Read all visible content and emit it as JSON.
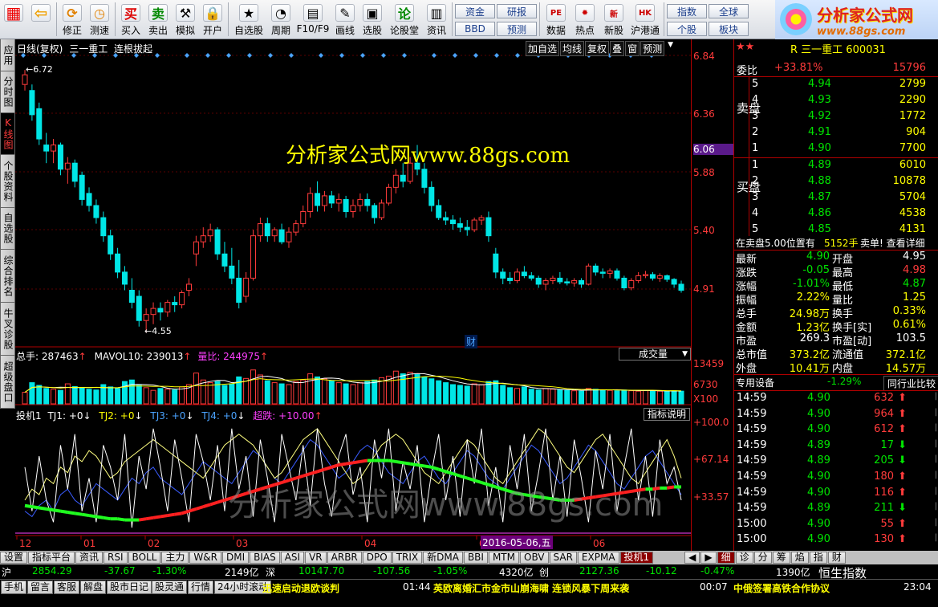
{
  "toolbar": {
    "items": [
      {
        "label": "",
        "icon": "windows-grid-icon"
      },
      {
        "label": "",
        "icon": "back-arrow-icon"
      },
      {
        "label": "修正",
        "icon": "refresh-icon"
      },
      {
        "label": "测速",
        "icon": "clock-icon"
      },
      {
        "label": "买入",
        "icon": "buy-icon",
        "glyph": "买"
      },
      {
        "label": "卖出",
        "icon": "sell-icon",
        "glyph": "卖"
      },
      {
        "label": "模拟",
        "icon": "hammer-icon"
      },
      {
        "label": "开户",
        "icon": "lock-icon"
      },
      {
        "label": "自选股",
        "icon": "star-icon"
      },
      {
        "label": "周期",
        "icon": "cycle-icon"
      },
      {
        "label": "F10/F9",
        "icon": "f10-icon"
      },
      {
        "label": "画线",
        "icon": "pen-icon"
      },
      {
        "label": "选股",
        "icon": "screen-icon"
      },
      {
        "label": "论股堂",
        "icon": "discuss-icon",
        "glyph": "论"
      },
      {
        "label": "资讯",
        "icon": "news-icon"
      }
    ],
    "mini": [
      [
        "资金",
        "BBD"
      ],
      [
        "研报",
        "预测"
      ]
    ],
    "items2": [
      {
        "label": "数据",
        "icon": "pe-icon",
        "glyph": "PE"
      },
      {
        "label": "热点",
        "icon": "hot-icon"
      },
      {
        "label": "新股",
        "icon": "new-stock-icon",
        "glyph": "新"
      },
      {
        "label": "沪港通",
        "icon": "hk-link-icon",
        "glyph": "HK"
      }
    ],
    "mini2": [
      [
        "指数",
        "个股"
      ],
      [
        "全球",
        "板块"
      ]
    ]
  },
  "logo": {
    "title": "分析家公式网",
    "url": "www.88gs.com"
  },
  "vtabs": [
    {
      "label": "应用"
    },
    {
      "label": "分时图"
    },
    {
      "label": "K线图",
      "active": true
    },
    {
      "label": "个股资料"
    },
    {
      "label": "自选股"
    },
    {
      "label": "综合排名"
    },
    {
      "label": "牛叉诊股"
    },
    {
      "label": "超级盘口"
    }
  ],
  "chart": {
    "header": {
      "period": "日线(复权)",
      "name": "三一重工",
      "signal": "连根拔起"
    },
    "menu": [
      "加自选",
      "均线",
      "复权",
      "叠",
      "窗",
      "预测"
    ],
    "high_label": "6.72",
    "low_label": "4.55",
    "watermark1": "分析家公式网www.88gs.com",
    "watermark2": "分析家公式网www.88gs.com",
    "cai": "财",
    "price_axis": [
      "6.84",
      "6.36",
      "6.06",
      "5.88",
      "5.40",
      "4.91"
    ],
    "vol_title": "总手: 287463",
    "mavol": "MAVOL10: 239013",
    "liangbi": "量比: 244975",
    "vol_select": "成交量",
    "vol_axis": [
      "13459",
      "6730",
      "X100"
    ],
    "ind_title": "投机1",
    "tj1": "TJ1: +0",
    "tj2": "TJ2: +0",
    "tj3": "TJ3: +0",
    "tj4": "TJ4: +0",
    "chaodie": "超跌: +10.00",
    "ind_btn": "指标说明",
    "ind_axis": [
      "+100.0",
      "+67.14",
      "+33.57"
    ],
    "months": [
      "12",
      "01",
      "02",
      "03",
      "04",
      "05",
      "06"
    ],
    "date_label": "2016-05-06,五"
  },
  "chart_data": {
    "type": "candlestick",
    "ylim": [
      4.55,
      6.84
    ],
    "ohlc": [
      [
        6.6,
        6.72,
        6.55,
        6.68
      ],
      [
        6.55,
        6.6,
        6.3,
        6.35
      ],
      [
        6.4,
        6.45,
        6.1,
        6.15
      ],
      [
        6.1,
        6.2,
        5.95,
        6.05
      ],
      [
        6.05,
        6.15,
        5.95,
        6.1
      ],
      [
        6.1,
        6.12,
        5.85,
        5.9
      ],
      [
        5.9,
        6.0,
        5.78,
        5.95
      ],
      [
        5.95,
        5.98,
        5.75,
        5.8
      ],
      [
        5.85,
        5.88,
        5.6,
        5.65
      ],
      [
        5.7,
        5.75,
        5.55,
        5.6
      ],
      [
        5.6,
        5.65,
        5.45,
        5.5
      ],
      [
        5.5,
        5.55,
        5.3,
        5.35
      ],
      [
        5.35,
        5.4,
        5.15,
        5.2
      ],
      [
        5.2,
        5.25,
        5.0,
        5.05
      ],
      [
        5.05,
        5.1,
        4.9,
        4.95
      ],
      [
        4.9,
        5.0,
        4.75,
        4.8
      ],
      [
        4.85,
        4.9,
        4.6,
        4.65
      ],
      [
        4.65,
        4.75,
        4.55,
        4.7
      ],
      [
        4.7,
        4.8,
        4.62,
        4.75
      ],
      [
        4.75,
        4.8,
        4.65,
        4.72
      ],
      [
        4.72,
        4.82,
        4.68,
        4.8
      ],
      [
        4.8,
        4.85,
        4.72,
        4.78
      ],
      [
        4.78,
        4.9,
        4.75,
        4.88
      ],
      [
        4.9,
        5.0,
        4.85,
        4.95
      ],
      [
        5.2,
        5.35,
        5.1,
        5.3
      ],
      [
        5.3,
        5.42,
        5.25,
        5.35
      ],
      [
        5.35,
        5.45,
        5.3,
        5.4
      ],
      [
        5.4,
        5.42,
        5.15,
        5.2
      ],
      [
        5.2,
        5.3,
        5.05,
        5.1
      ],
      [
        5.1,
        5.25,
        4.95,
        5.0
      ],
      [
        5.0,
        5.15,
        4.75,
        4.8
      ],
      [
        4.85,
        5.05,
        4.8,
        5.0
      ],
      [
        5.0,
        5.4,
        4.98,
        5.35
      ],
      [
        5.35,
        5.5,
        5.3,
        5.45
      ],
      [
        5.45,
        5.5,
        5.3,
        5.35
      ],
      [
        5.35,
        5.42,
        5.3,
        5.4
      ],
      [
        5.4,
        5.45,
        5.28,
        5.3
      ],
      [
        5.3,
        5.42,
        5.25,
        5.38
      ],
      [
        5.38,
        5.48,
        5.35,
        5.45
      ],
      [
        5.45,
        5.6,
        5.42,
        5.55
      ],
      [
        5.55,
        5.75,
        5.5,
        5.7
      ],
      [
        5.7,
        5.8,
        5.55,
        5.6
      ],
      [
        5.6,
        5.72,
        5.55,
        5.68
      ],
      [
        5.68,
        5.72,
        5.58,
        5.62
      ],
      [
        5.62,
        5.7,
        5.55,
        5.65
      ],
      [
        5.65,
        5.68,
        5.5,
        5.55
      ],
      [
        5.55,
        5.65,
        5.5,
        5.6
      ],
      [
        5.6,
        5.7,
        5.55,
        5.65
      ],
      [
        5.65,
        5.7,
        5.55,
        5.6
      ],
      [
        5.6,
        5.62,
        5.45,
        5.5
      ],
      [
        5.5,
        5.65,
        5.48,
        5.62
      ],
      [
        5.62,
        5.78,
        5.6,
        5.75
      ],
      [
        5.75,
        5.9,
        5.7,
        5.85
      ],
      [
        5.85,
        5.95,
        5.75,
        5.8
      ],
      [
        5.8,
        6.0,
        5.78,
        5.95
      ],
      [
        5.95,
        6.1,
        5.85,
        5.9
      ],
      [
        5.9,
        5.95,
        5.7,
        5.75
      ],
      [
        5.75,
        5.8,
        5.55,
        5.6
      ],
      [
        5.6,
        5.65,
        5.48,
        5.5
      ],
      [
        5.5,
        5.55,
        5.44,
        5.48
      ],
      [
        5.48,
        5.52,
        5.4,
        5.45
      ],
      [
        5.45,
        5.5,
        5.38,
        5.42
      ],
      [
        5.42,
        5.48,
        5.35,
        5.4
      ],
      [
        5.4,
        5.5,
        5.38,
        5.48
      ],
      [
        5.48,
        5.52,
        5.44,
        5.5
      ],
      [
        5.5,
        5.55,
        5.3,
        5.35
      ],
      [
        5.2,
        5.25,
        5.0,
        5.05
      ],
      [
        5.05,
        5.08,
        4.95,
        5.0
      ],
      [
        5.0,
        5.05,
        4.95,
        4.98
      ],
      [
        4.98,
        5.08,
        4.96,
        5.05
      ],
      [
        5.05,
        5.1,
        5.0,
        5.02
      ],
      [
        5.02,
        5.05,
        4.98,
        5.0
      ],
      [
        5.0,
        5.02,
        4.92,
        4.95
      ],
      [
        4.95,
        5.0,
        4.9,
        4.98
      ],
      [
        4.98,
        5.02,
        4.95,
        5.0
      ],
      [
        5.0,
        5.05,
        4.95,
        4.97
      ],
      [
        4.97,
        5.0,
        4.94,
        4.96
      ],
      [
        4.96,
        5.0,
        4.93,
        4.98
      ],
      [
        4.98,
        5.0,
        4.92,
        4.95
      ],
      [
        4.95,
        5.12,
        4.94,
        5.1
      ],
      [
        5.1,
        5.12,
        5.02,
        5.05
      ],
      [
        5.05,
        5.08,
        5.0,
        5.04
      ],
      [
        5.04,
        5.08,
        5.0,
        5.06
      ],
      [
        5.06,
        5.08,
        4.98,
        5.0
      ],
      [
        5.0,
        5.02,
        4.9,
        4.92
      ],
      [
        4.92,
        5.0,
        4.9,
        4.98
      ],
      [
        4.98,
        5.05,
        4.96,
        5.02
      ],
      [
        5.02,
        5.06,
        5.0,
        5.03
      ],
      [
        5.03,
        5.05,
        4.98,
        5.0
      ],
      [
        5.0,
        5.04,
        4.97,
        5.02
      ],
      [
        5.02,
        5.03,
        4.97,
        4.99
      ],
      [
        4.99,
        5.0,
        4.92,
        4.95
      ],
      [
        4.95,
        4.98,
        4.88,
        4.9
      ]
    ],
    "volume": [
      30,
      55,
      48,
      40,
      38,
      35,
      52,
      45,
      42,
      38,
      36,
      50,
      44,
      40,
      58,
      62,
      48,
      42,
      35,
      40,
      38,
      36,
      44,
      50,
      80,
      62,
      55,
      58,
      48,
      52,
      70,
      66,
      88,
      75,
      60,
      55,
      52,
      50,
      58,
      62,
      78,
      70,
      65,
      60,
      55,
      52,
      50,
      55,
      58,
      62,
      68,
      72,
      85,
      78,
      82,
      76,
      70,
      65,
      60,
      55,
      50,
      48,
      46,
      52,
      50,
      58,
      60,
      48,
      42,
      40,
      44,
      38,
      36,
      40,
      38,
      36,
      35,
      34,
      33,
      40,
      38,
      36,
      35,
      34,
      36,
      34,
      33,
      35,
      34,
      33,
      32,
      34,
      33
    ],
    "indicator": {
      "white": [
        60,
        20,
        70,
        30,
        10,
        80,
        40,
        90,
        20,
        50,
        10,
        80,
        60,
        30,
        90,
        5,
        70,
        40,
        95,
        60,
        20,
        85,
        50,
        10,
        90,
        65,
        30,
        80,
        20,
        95,
        40,
        70,
        15,
        85,
        50,
        10,
        90,
        60,
        30,
        80,
        25,
        95,
        45,
        15,
        70,
        90,
        35,
        60,
        10,
        85,
        50,
        95,
        20,
        65,
        40,
        80,
        10,
        55,
        90,
        30,
        70,
        15,
        85,
        45,
        95,
        25,
        60,
        10,
        80,
        40,
        90,
        20,
        55,
        95,
        30,
        70,
        15,
        85,
        50,
        10,
        75,
        40,
        90,
        20,
        60,
        95,
        30,
        70,
        15,
        85,
        45,
        60,
        30
      ],
      "yellow": [
        30,
        40,
        35,
        50,
        45,
        60,
        55,
        70,
        65,
        75,
        70,
        60,
        50,
        55,
        65,
        70,
        75,
        80,
        85,
        80,
        75,
        70,
        65,
        60,
        55,
        50,
        60,
        70,
        80,
        85,
        90,
        85,
        80,
        70,
        60,
        50,
        55,
        65,
        75,
        85,
        90,
        95,
        85,
        75,
        65,
        55,
        45,
        50,
        60,
        70,
        80,
        85,
        90,
        85,
        75,
        65,
        55,
        50,
        45,
        55,
        65,
        75,
        85,
        80,
        70,
        60,
        50,
        45,
        55,
        65,
        75,
        85,
        95,
        90,
        80,
        70,
        60,
        55,
        65,
        75,
        85,
        90,
        80,
        70,
        60,
        50,
        45,
        55,
        65,
        75,
        85,
        70,
        50
      ],
      "blue": [
        20,
        15,
        25,
        30,
        20,
        35,
        40,
        30,
        25,
        35,
        45,
        40,
        35,
        30,
        40,
        50,
        45,
        55,
        60,
        50,
        45,
        40,
        35,
        45,
        55,
        65,
        60,
        55,
        50,
        45,
        55,
        65,
        75,
        70,
        60,
        50,
        45,
        55,
        65,
        75,
        85,
        80,
        70,
        60,
        50,
        55,
        65,
        75,
        80,
        75,
        65,
        55,
        50,
        45,
        55,
        65,
        70,
        60,
        50,
        45,
        55,
        65,
        75,
        70,
        60,
        50,
        45,
        40,
        50,
        60,
        70,
        80,
        75,
        65,
        55,
        45,
        50,
        60,
        70,
        80,
        75,
        65,
        55,
        45,
        40,
        50,
        60,
        70,
        75,
        65,
        55,
        45,
        35
      ],
      "ma": [
        25,
        24,
        23,
        22,
        21,
        20,
        19,
        18,
        17,
        16,
        15,
        14,
        13,
        13,
        12,
        12,
        12,
        13,
        14,
        15,
        16,
        17,
        18,
        20,
        22,
        24,
        26,
        28,
        30,
        32,
        34,
        36,
        38,
        40,
        42,
        44,
        46,
        48,
        50,
        52,
        54,
        56,
        58,
        60,
        62,
        63,
        64,
        65,
        66,
        66,
        66,
        66,
        65,
        64,
        63,
        62,
        61,
        60,
        58,
        56,
        54,
        52,
        50,
        48,
        46,
        44,
        42,
        40,
        38,
        36,
        35,
        34,
        33,
        32,
        31,
        30,
        30,
        30,
        31,
        32,
        33,
        34,
        35,
        36,
        37,
        38,
        39,
        40,
        40,
        41,
        41,
        42,
        42
      ]
    }
  },
  "quote": {
    "title": "R 三一重工 600031",
    "weibi_label": "委比",
    "weibi": "+33.81%",
    "weibi_diff": "15796",
    "sell_label": "卖盘",
    "buy_label": "买盘",
    "sell": [
      [
        "5",
        "4.94",
        "2799"
      ],
      [
        "4",
        "4.93",
        "2290"
      ],
      [
        "3",
        "4.92",
        "1772"
      ],
      [
        "2",
        "4.91",
        "904"
      ],
      [
        "1",
        "4.90",
        "7700"
      ]
    ],
    "buy": [
      [
        "1",
        "4.89",
        "6010"
      ],
      [
        "2",
        "4.88",
        "10878"
      ],
      [
        "3",
        "4.87",
        "5704"
      ],
      [
        "4",
        "4.86",
        "4538"
      ],
      [
        "5",
        "4.85",
        "4131"
      ]
    ],
    "notice": "在卖盘5.00位置有",
    "notice2": "5152手",
    "notice3": "卖单! 查看详细",
    "stats": [
      [
        "最新",
        "4.90",
        "开盘",
        "4.95"
      ],
      [
        "涨跌",
        "-0.05",
        "最高",
        "4.98"
      ],
      [
        "涨幅",
        "-1.01%",
        "最低",
        "4.87"
      ],
      [
        "振幅",
        "2.22%",
        "量比",
        "1.25"
      ],
      [
        "总手",
        "24.98万",
        "换手",
        "0.33%"
      ],
      [
        "金额",
        "1.23亿",
        "换手[实]",
        "0.61%"
      ],
      [
        "市盈",
        "269.3",
        "市盈[动]",
        "103.5"
      ],
      [
        "总市值",
        "373.2亿",
        "流通值",
        "372.1亿"
      ],
      [
        "外盘",
        "10.41万",
        "内盘",
        "14.57万"
      ]
    ],
    "sector": "专用设备",
    "sector_pct": "-1.29%",
    "compare_btn": "同行业比较",
    "ticks": [
      [
        "14:59",
        "4.90",
        "632",
        "up"
      ],
      [
        "14:59",
        "4.90",
        "964",
        "up"
      ],
      [
        "14:59",
        "4.90",
        "612",
        "up"
      ],
      [
        "14:59",
        "4.89",
        "17",
        "down"
      ],
      [
        "14:59",
        "4.89",
        "205",
        "down"
      ],
      [
        "14:59",
        "4.90",
        "180",
        "up"
      ],
      [
        "14:59",
        "4.90",
        "116",
        "up"
      ],
      [
        "14:59",
        "4.89",
        "211",
        "down"
      ],
      [
        "15:00",
        "4.90",
        "55",
        "up"
      ],
      [
        "15:00",
        "4.90",
        "130",
        "up"
      ]
    ],
    "tabs": [
      "细",
      "诊",
      "分",
      "筹",
      "焰",
      "指",
      "财"
    ]
  },
  "index_tabs": [
    "设置",
    "指标平台",
    "资讯",
    "RSI",
    "BOLL",
    "主力",
    "W&R",
    "DMI",
    "BIAS",
    "ASI",
    "VR",
    "ARBR",
    "DPO",
    "TRIX",
    "新DMA",
    "BBI",
    "MTM",
    "OBV",
    "SAR",
    "EXPMA",
    "投机1"
  ],
  "index_tabs_active": "投机1",
  "status1": {
    "sh_label": "沪",
    "sh": "2854.29",
    "sh_chg": "-37.67",
    "sh_pct": "-1.30%",
    "sh_amt": "2149亿",
    "sz_label": "深",
    "sz": "10147.70",
    "sz_chg": "-107.56",
    "sz_pct": "-1.05%",
    "sz_amt": "4320亿",
    "cy_label": "创",
    "cy": "2127.36",
    "cy_chg": "-10.12",
    "cy_pct": "-0.47%",
    "cy_amt": "1390亿",
    "hs": "恒生指数"
  },
  "status2": {
    "btns": [
      "手机",
      "留言",
      "客服",
      "解盘",
      "股市日记",
      "股灵通",
      "行情",
      "24小时滚动"
    ],
    "news1": "迅速启动退欧谈判",
    "time1": "01:44",
    "news2": "英欧离婚汇市金市山崩海啸 连锁风暴下周来袭",
    "time2": "00:07",
    "news3": "中俄签署高铁合作协议",
    "clock": "23:04"
  },
  "colors": {
    "up": "#ff3b3b",
    "down": "#00e6e6",
    "green": "#00e400",
    "yellow": "#ffff00",
    "axis_red": "#b00000"
  }
}
